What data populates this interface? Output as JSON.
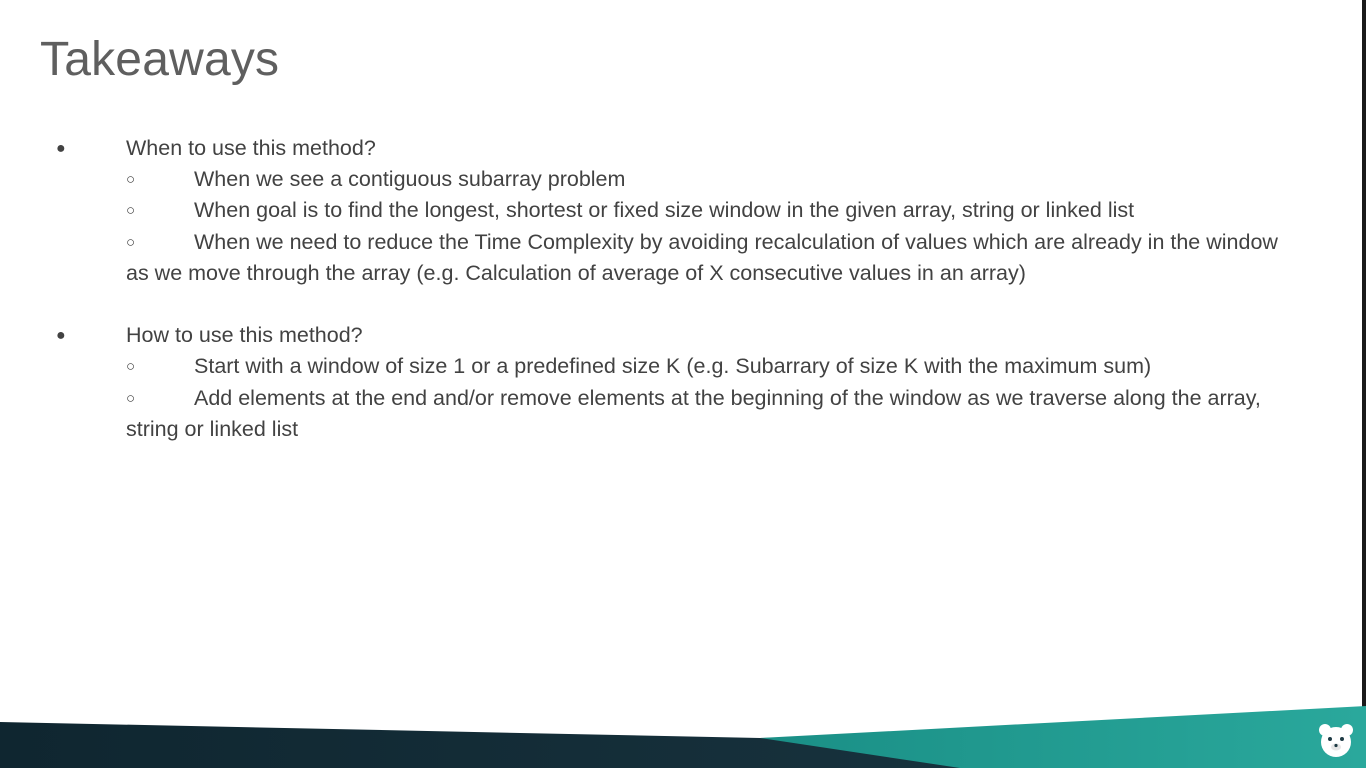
{
  "slide": {
    "title": "Takeaways",
    "sections": [
      {
        "heading": "When to use this method?",
        "items": [
          "When we see a contiguous subarray problem",
          "When goal is to find the longest, shortest or fixed size window in the given array, string or linked list",
          "When we need to reduce the Time Complexity by avoiding recalculation of values which are already in the window as we move through the array (e.g. Calculation of average of X consecutive values in an array)"
        ]
      },
      {
        "heading": "How to use this method?",
        "items": [
          "Start with a window of size 1 or a predefined size K (e.g. Subarrary of size K with the maximum sum)",
          "Add elements at the end and/or remove elements at the beginning of the window as we traverse along the array, string or linked list"
        ]
      }
    ],
    "bullet_glyph": "●",
    "sub_bullet_glyph": "○"
  },
  "theme": {
    "background": "#ffffff",
    "text": "#424242",
    "title": "#5f5f5f",
    "footer_dark": "#16303b",
    "footer_teal": "#1e9e93"
  },
  "icons": {
    "mascot": "bear-logo-icon"
  }
}
